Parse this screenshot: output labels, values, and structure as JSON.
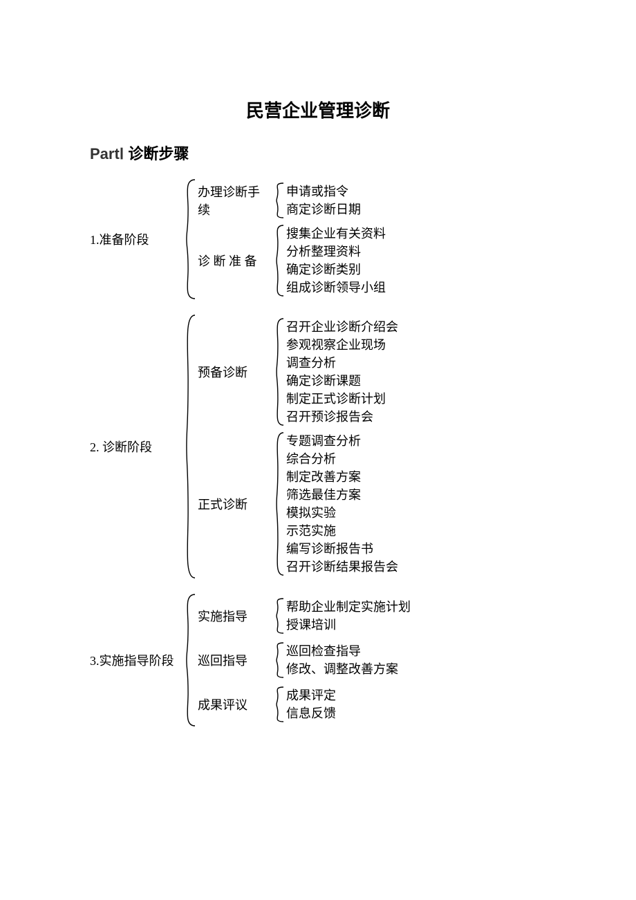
{
  "title": "民营企业管理诊断",
  "subtitle_part": "PartⅠ",
  "subtitle_text": " 诊断步骤",
  "tree": [
    {
      "label": "1.准备阶段",
      "children": [
        {
          "label": "办理诊断手续",
          "leaves": [
            "申请或指令",
            "商定诊断日期"
          ]
        },
        {
          "label": "诊 断 准 备",
          "leaves": [
            "搜集企业有关资料",
            "分析整理资料",
            "确定诊断类别",
            "组成诊断领导小组"
          ]
        }
      ]
    },
    {
      "label": "2. 诊断阶段",
      "children": [
        {
          "label": "预备诊断",
          "leaves": [
            "召开企业诊断介绍会",
            "参观视察企业现场",
            "调查分析",
            "确定诊断课题",
            "制定正式诊断计划",
            "召开预诊报告会"
          ]
        },
        {
          "label": "正式诊断",
          "leaves": [
            "专题调查分析",
            "综合分析",
            "制定改善方案",
            "筛选最佳方案",
            "模拟实验",
            "示范实施",
            "编写诊断报告书",
            "召开诊断结果报告会"
          ]
        }
      ]
    },
    {
      "label": "3.实施指导阶段",
      "children": [
        {
          "label": "实施指导",
          "leaves": [
            "帮助企业制定实施计划",
            "授课培训"
          ]
        },
        {
          "label": "巡回指导",
          "leaves": [
            "巡回检查指导",
            "修改、调整改善方案"
          ]
        },
        {
          "label": "成果评议",
          "leaves": [
            "成果评定",
            "信息反馈"
          ]
        }
      ]
    }
  ]
}
